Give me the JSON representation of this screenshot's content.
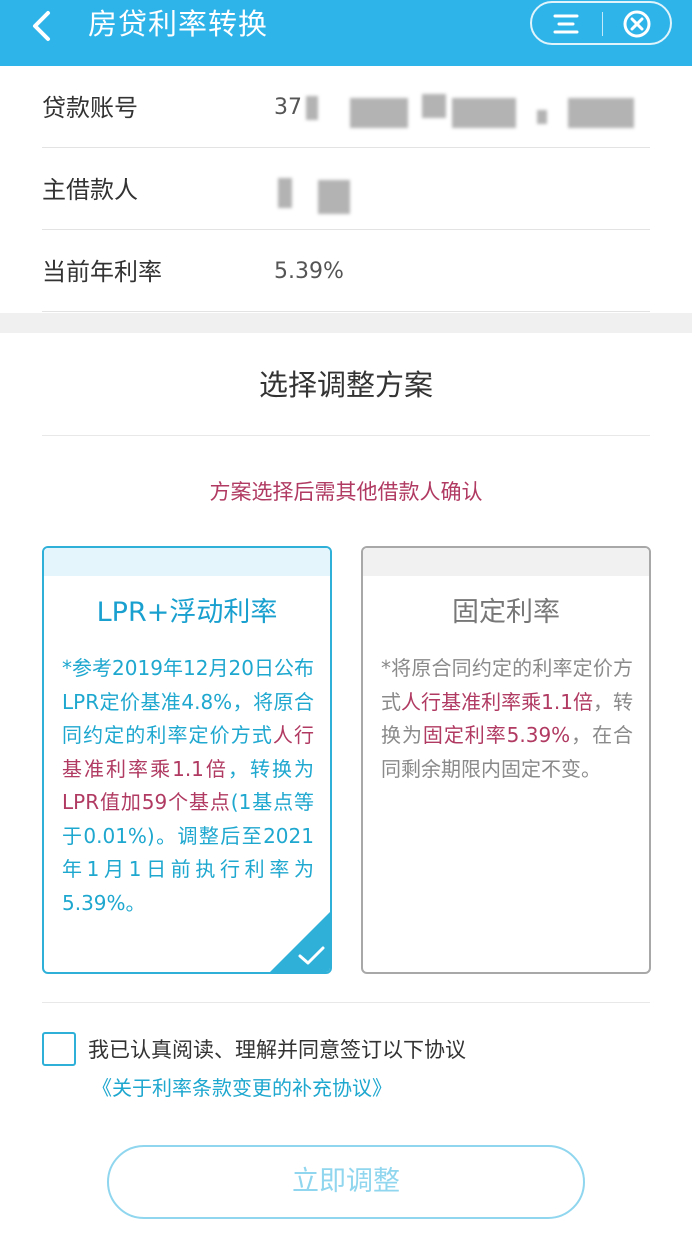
{
  "header": {
    "title": "房贷利率转换",
    "back_icon": "chevron-left-icon",
    "menu_icon": "menu-icon",
    "close_icon": "close-circle-icon",
    "bg_color": "#2fb4ea"
  },
  "info": {
    "account_label": "贷款账号",
    "account_value": "37",
    "borrower_label": "主借款人",
    "borrower_value": "",
    "rate_label": "当前年利率",
    "rate_value": "5.39%"
  },
  "plan": {
    "section_title": "选择调整方案",
    "notice": "方案选择后需其他借款人确认",
    "lpr": {
      "title": "LPR+浮动利率",
      "text_1": "*参考2019年12月20日公布LPR定价基准4.8%，将原合同约定的利率定价方式",
      "text_hl_1": "人行基准利率乘1.1倍",
      "text_2": "，转换为",
      "text_hl_2": "LPR值加59个基点",
      "text_3": "(1基点等于0.01%)。调整后至2021年1月1日前执行利率为5.39%。",
      "selected": true
    },
    "fixed": {
      "title": "固定利率",
      "text_1": "*将原合同约定的利率定价方式",
      "text_hl_1": "人行基准利率乘1.1倍",
      "text_2": "，转换为",
      "text_hl_2": "固定利率5.39%",
      "text_3": "，在合同剩余期限内固定不变。",
      "selected": false
    }
  },
  "agreement": {
    "text": "我已认真阅读、理解并同意签订以下协议",
    "link": "《关于利率条款变更的补充协议》",
    "checked": false
  },
  "submit": {
    "label": "立即调整"
  },
  "colors": {
    "accent": "#2fb0d9",
    "highlight": "#b03a62",
    "disabled_button": "#8fd6ee"
  }
}
